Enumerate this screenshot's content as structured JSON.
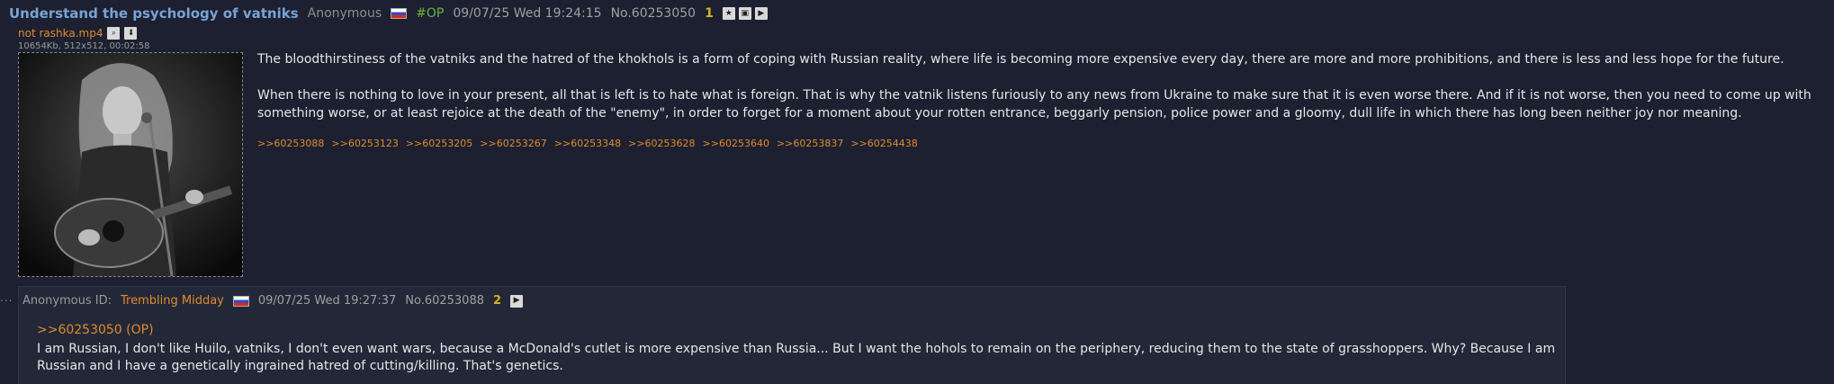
{
  "op": {
    "subject": "Understand the psychology of vatniks",
    "name": "Anonymous",
    "flag_colors": [
      "#ffffff",
      "#1f4fd1",
      "#d52b1e"
    ],
    "op_tag": "#OP",
    "datetime": "09/07/25 Wed 19:24:15",
    "post_number": "No.60253050",
    "reply_count": "1",
    "header_icons": [
      "star-icon",
      "images-icon",
      "play-icon"
    ],
    "file": {
      "name": "not rashka.mp4",
      "icons": [
        "search-icon",
        "download-icon"
      ],
      "meta": "10654Kb, 512x512, 00:02:58"
    },
    "paragraphs": [
      "The bloodthirstiness of the vatniks and the hatred of the khokhols is a form of coping with Russian reality, where life is becoming more expensive every day, there are more and more prohibitions, and there is less and less hope for the future.",
      "When there is nothing to love in your present, all that is left is to hate what is foreign. That is why the vatnik listens furiously to any news from Ukraine to make sure that it is even worse there. And if it is not worse, then you need to come up with something worse, or at least rejoice at the death of the \"enemy\", in order to forget for a moment about your rotten entrance, beggarly pension, police power and a gloomy, dull life in which there has long been neither joy nor meaning."
    ],
    "reply_links": [
      ">>60253088",
      ">>60253123",
      ">>60253205",
      ">>60253267",
      ">>60253348",
      ">>60253628",
      ">>60253640",
      ">>60253837",
      ">>60254438"
    ]
  },
  "reply": {
    "dots": "...",
    "name_label": "Anonymous ID:",
    "poster_id": "Trembling Midday",
    "datetime": "09/07/25 Wed 19:27:37",
    "post_number": "No.60253088",
    "reply_count": "2",
    "quote": ">>60253050 (OP)",
    "text": "I am Russian, I don't like Huilo, vatniks, I don't even want wars, because a McDonald's cutlet is more expensive than Russia... But I want the hohols to remain on the periphery, reducing them to the state of grasshoppers. Why? Because I am Russian and I have a genetically ingrained hatred of cutting/killing. That's genetics."
  },
  "colors": {
    "background": "#1c2030",
    "subject": "#7aa2d6",
    "link": "#e08a2e",
    "op_tag": "#6cb343",
    "reply_count": "#d6b21f"
  }
}
